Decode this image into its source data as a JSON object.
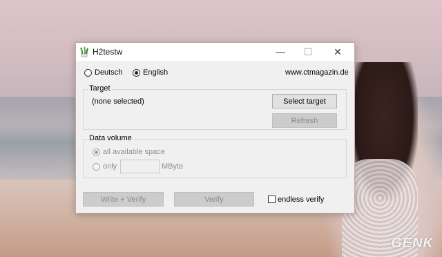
{
  "window": {
    "title": "H2testw",
    "minimize_glyph": "—",
    "maximize_glyph": "☐",
    "close_glyph": "✕"
  },
  "language": {
    "options": [
      "Deutsch",
      "English"
    ],
    "selected": "English"
  },
  "website": "www.ctmagazin.de",
  "target": {
    "group_title": "Target",
    "selection_text": "(none selected)",
    "select_button": "Select target",
    "refresh_button": "Refresh"
  },
  "data_volume": {
    "group_title": "Data volume",
    "option_all": "all available space",
    "option_only": "only",
    "only_value": "",
    "unit": "MByte"
  },
  "actions": {
    "write_verify": "Write + Verify",
    "verify": "Verify",
    "endless_verify": "endless verify"
  },
  "watermark": "GENK"
}
